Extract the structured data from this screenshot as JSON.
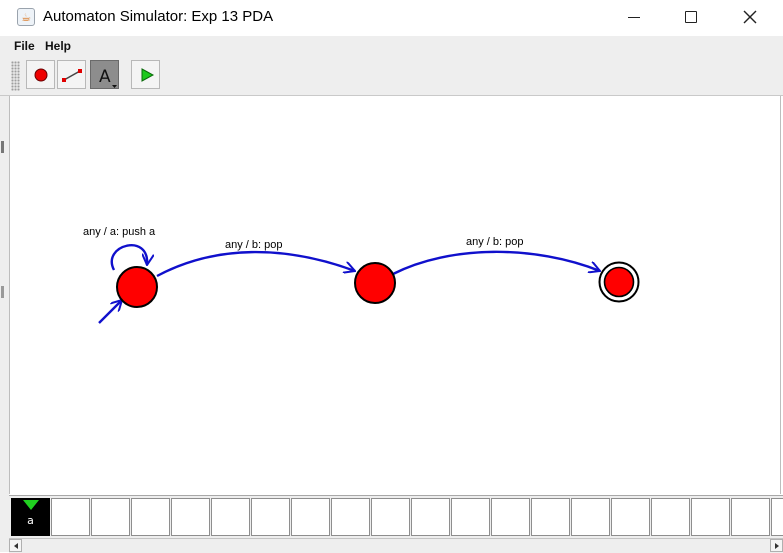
{
  "window": {
    "title": "Automaton Simulator: Exp 13 PDA",
    "icon": "java-cup-icon"
  },
  "menu": {
    "items": [
      {
        "label": "File"
      },
      {
        "label": "Help"
      }
    ]
  },
  "toolbar": {
    "tools": [
      {
        "name": "state-tool",
        "icon": "red-circle-icon"
      },
      {
        "name": "transition-tool",
        "icon": "arrow-line-icon"
      },
      {
        "name": "label-tool",
        "icon": "letter-a-icon",
        "glyph": "A",
        "selected": true
      },
      {
        "name": "run-tool",
        "icon": "play-icon"
      }
    ]
  },
  "automaton": {
    "state_color": "#ff0000",
    "edge_color": "#1010cc",
    "states": [
      {
        "id": "q0",
        "initial": true,
        "accepting": false
      },
      {
        "id": "q1",
        "initial": false,
        "accepting": false
      },
      {
        "id": "q2",
        "initial": false,
        "accepting": true
      }
    ],
    "transitions": [
      {
        "from": "q0",
        "to": "q0",
        "label": "any / a: push a"
      },
      {
        "from": "q0",
        "to": "q1",
        "label": "any / b: pop"
      },
      {
        "from": "q1",
        "to": "q2",
        "label": "any / b: pop"
      }
    ]
  },
  "tape": {
    "cells": [
      "a",
      "",
      "",
      "",
      "",
      "",
      "",
      "",
      "",
      "",
      "",
      "",
      "",
      "",
      "",
      "",
      "",
      "",
      "",
      ""
    ],
    "head_position": 0,
    "head_color": "#20d020"
  }
}
